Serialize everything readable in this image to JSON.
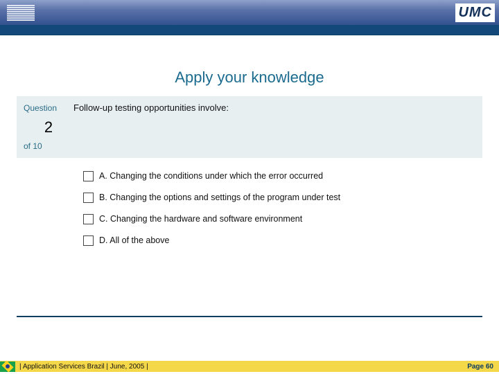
{
  "header": {
    "left_logo": "IBM",
    "right_logo": "UMC"
  },
  "slide": {
    "title": "Apply your knowledge",
    "question_label": "Question",
    "question_number": "2",
    "question_of": "of 10",
    "question_text": "Follow-up testing opportunities involve:",
    "options": [
      {
        "label": "A. Changing the conditions under which the error occurred"
      },
      {
        "label": "B. Changing the options and settings of the program under test"
      },
      {
        "label": "C. Changing the hardware and software environment"
      },
      {
        "label": "D. All of the above"
      }
    ]
  },
  "footer": {
    "text": "|  Application Services Brazil  |  June, 2005  |",
    "page": "Page 60"
  }
}
